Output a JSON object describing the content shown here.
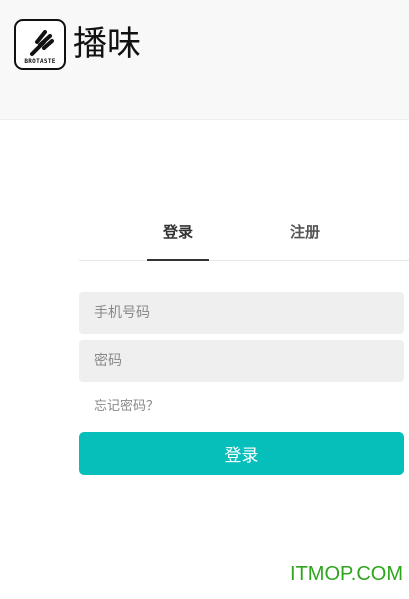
{
  "header": {
    "logo_text": "BROTASTE",
    "app_name": "播味"
  },
  "tabs": [
    {
      "label": "登录",
      "active": true
    },
    {
      "label": "注册",
      "active": false
    }
  ],
  "form": {
    "phone_placeholder": "手机号码",
    "password_placeholder": "密码",
    "forgot_label": "忘记密码？",
    "submit_label": "登录"
  },
  "colors": {
    "accent": "#06bfbb",
    "header_bg": "#f8f8f8",
    "input_bg": "#efefef"
  },
  "watermark": "ITMOP.COM"
}
